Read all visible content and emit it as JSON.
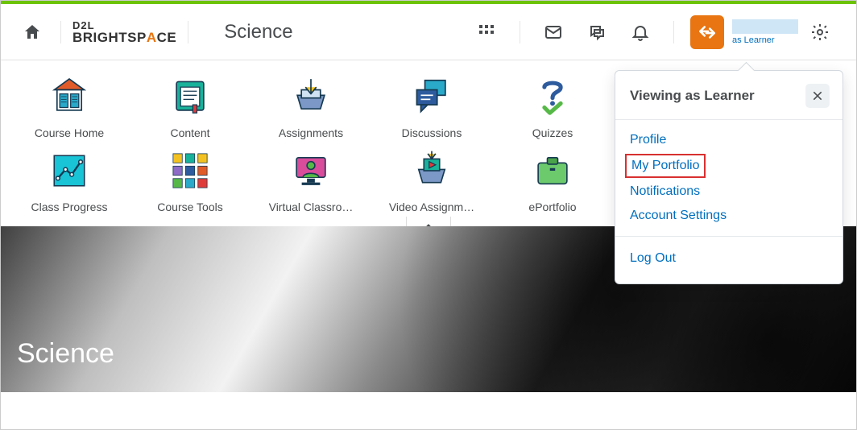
{
  "header": {
    "logo_top": "D2L",
    "logo_bottom_pre": "BRIGHTSP",
    "logo_bottom_accent": "A",
    "logo_bottom_post": "CE",
    "course_title": "Science",
    "user_sub": "as Learner"
  },
  "nav": {
    "items": [
      {
        "label": "Course Home"
      },
      {
        "label": "Content"
      },
      {
        "label": "Assignments"
      },
      {
        "label": "Discussions"
      },
      {
        "label": "Quizzes"
      },
      {
        "label": "Class Progress"
      },
      {
        "label": "Course Tools"
      },
      {
        "label": "Virtual Classro…"
      },
      {
        "label": "Video Assignm…"
      },
      {
        "label": "ePortfolio"
      }
    ]
  },
  "banner": {
    "title": "Science"
  },
  "dropdown": {
    "title": "Viewing as Learner",
    "items": [
      {
        "label": "Profile"
      },
      {
        "label": "My Portfolio",
        "highlight": true
      },
      {
        "label": "Notifications"
      },
      {
        "label": "Account Settings"
      }
    ],
    "logout": "Log Out"
  },
  "colors": {
    "brand_orange": "#e87511",
    "link_blue": "#006fbf"
  }
}
